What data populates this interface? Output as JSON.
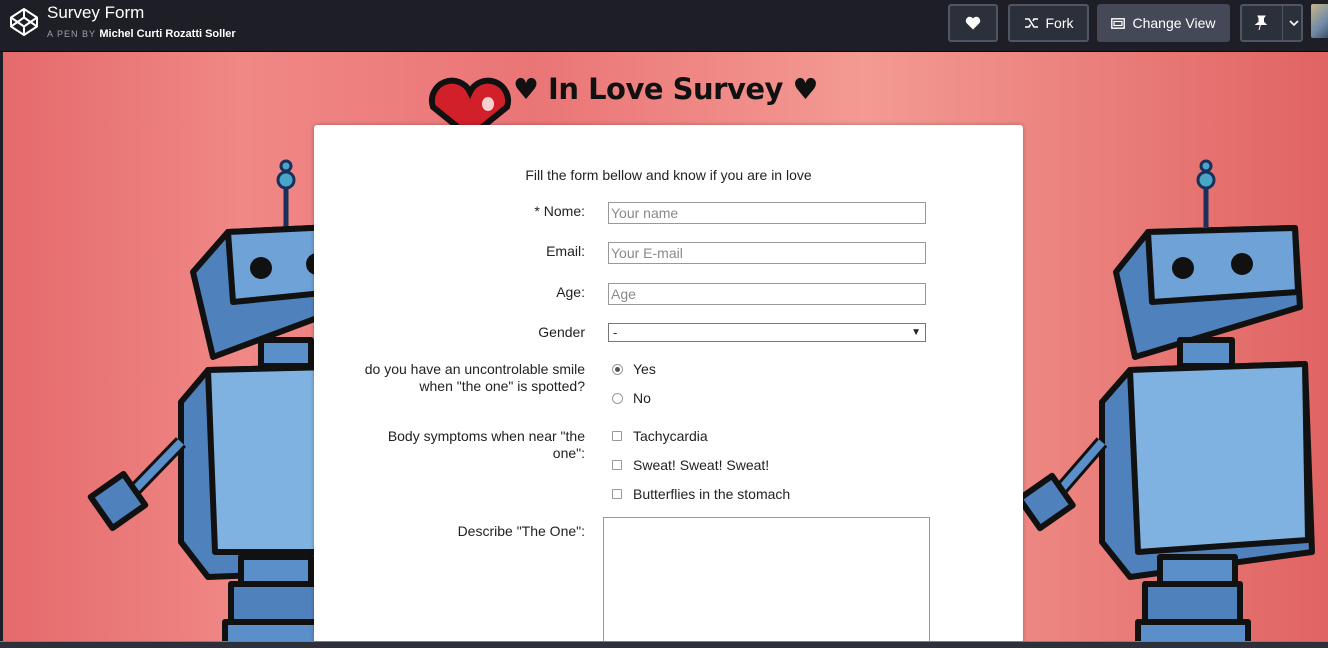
{
  "header": {
    "pen_title": "Survey Form",
    "pen_by_prefix": "A PEN BY",
    "author": "Michel Curti Rozatti Soller",
    "buttons": {
      "heart_icon": "heart-icon",
      "fork_label": "Fork",
      "change_view_label": "Change View",
      "pin_icon": "pin-icon"
    }
  },
  "survey": {
    "title": "♥ In Love Survey ♥",
    "intro": "Fill the form bellow and know if you are in love",
    "name_label": "* Nome:",
    "name_placeholder": "Your name",
    "email_label": "Email:",
    "email_placeholder": "Your E-mail",
    "age_label": "Age:",
    "age_placeholder": "Age",
    "gender_label": "Gender",
    "gender_selected": "-",
    "smile_label_line1": "do you have an uncontrolable smile",
    "smile_label_line2": "when \"the one\" is spotted?",
    "smile_options": [
      "Yes",
      "No"
    ],
    "smile_selected": "Yes",
    "symptoms_label_line1": "Body symptoms when near \"the",
    "symptoms_label_line2": "one\":",
    "symptom_options": [
      "Tachycardia",
      "Sweat! Sweat! Sweat!",
      "Butterflies in the stomach"
    ],
    "describe_label": "Describe \"The One\":"
  },
  "colors": {
    "header_bg": "#1e1f26",
    "background_pink": "#ea7576",
    "robot_blue": "#5b8fc9"
  }
}
